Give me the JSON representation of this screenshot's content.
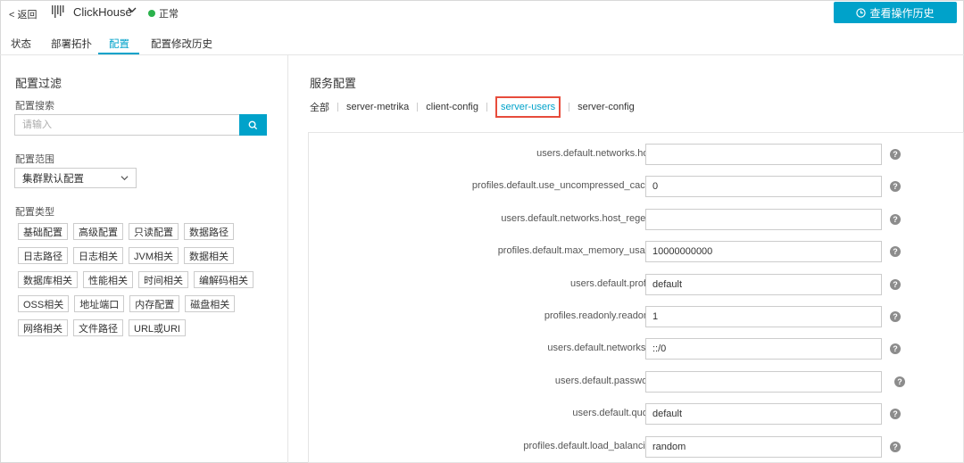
{
  "header": {
    "back_label": "< 返回",
    "app_name": "ClickHouse",
    "status": "正常",
    "history_button": "查看操作历史",
    "logo_icon": "bars-logo-icon",
    "accent_color": "#00a2ca"
  },
  "tabs": [
    {
      "label": "状态"
    },
    {
      "label": "部署拓扑"
    },
    {
      "label": "配置",
      "active": true
    },
    {
      "label": "配置修改历史"
    }
  ],
  "filter": {
    "title": "配置过滤",
    "search_label": "配置搜索",
    "search_placeholder": "请输入",
    "scope_label": "配置范围",
    "scope_value": "集群默认配置",
    "type_label": "配置类型",
    "type_rows": [
      [
        "基础配置",
        "高级配置",
        "只读配置",
        "数据路径"
      ],
      [
        "日志路径",
        "日志相关",
        "JVM相关",
        "数据相关"
      ],
      [
        "数据库相关",
        "性能相关",
        "时间相关",
        "编解码相关"
      ],
      [
        "OSS相关",
        "地址端口",
        "内存配置",
        "磁盘相关"
      ],
      [
        "网络相关",
        "文件路径",
        "URL或URI"
      ]
    ]
  },
  "service": {
    "title": "服务配置",
    "filters": [
      "全部",
      "server-metrika",
      "client-config",
      "server-users",
      "server-config"
    ],
    "active_filter": "server-users",
    "rows": [
      {
        "key": "users.default.networks.host",
        "value": ""
      },
      {
        "key": "profiles.default.use_uncompressed_cache",
        "value": "0"
      },
      {
        "key": "users.default.networks.host_regexp",
        "value": ""
      },
      {
        "key": "profiles.default.max_memory_usage",
        "value": "10000000000"
      },
      {
        "key": "users.default.profile",
        "value": "default"
      },
      {
        "key": "profiles.readonly.readonly",
        "value": "1"
      },
      {
        "key": "users.default.networks.ip",
        "value": "::/0"
      },
      {
        "key": "users.default.password",
        "value": ""
      },
      {
        "key": "users.default.quota",
        "value": "default"
      },
      {
        "key": "profiles.default.load_balancing",
        "value": "random"
      }
    ],
    "help_glyph": "?"
  }
}
